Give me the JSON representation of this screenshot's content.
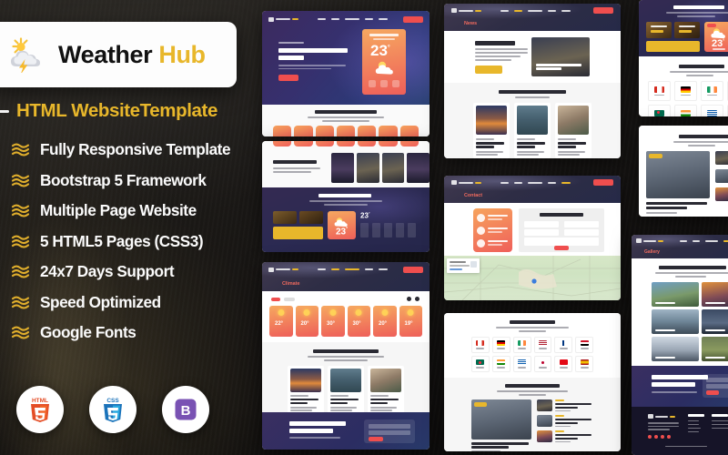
{
  "brand": {
    "name_primary": "Weather",
    "name_accent": "Hub",
    "icon": "sun-cloud-lightning-icon",
    "subtitle": "HTML WebsiteTemplate",
    "accent_color": "#e8b72b",
    "background_color": "#141210"
  },
  "features": [
    {
      "icon": "wave-bullet-icon",
      "label": "Fully Responsive Template"
    },
    {
      "icon": "wave-bullet-icon",
      "label": "Bootstrap 5 Framework"
    },
    {
      "icon": "wave-bullet-icon",
      "label": "Multiple Page Website"
    },
    {
      "icon": "wave-bullet-icon",
      "label": "5 HTML5 Pages (CSS3)"
    },
    {
      "icon": "wave-bullet-icon",
      "label": "24x7 Days Support"
    },
    {
      "icon": "wave-bullet-icon",
      "label": "Speed Optimized"
    },
    {
      "icon": "wave-bullet-icon",
      "label": "Google Fonts"
    }
  ],
  "tech_badges": [
    {
      "icon": "html5-icon",
      "label": "HTML",
      "number": "5",
      "color": "#e44d26"
    },
    {
      "icon": "css3-icon",
      "label": "CSS",
      "number": "3",
      "color": "#1b73ba"
    },
    {
      "icon": "bootstrap-icon",
      "label": "B",
      "number": "",
      "color": "#7952b3"
    }
  ],
  "mockups": {
    "home_hero": {
      "name": "Home",
      "nav_links": [
        "Home",
        "News",
        "Climate Change",
        "Gallery",
        "Contact"
      ],
      "nav_button": "Contact",
      "kicker": "Weather & Forecast",
      "title": "Daily Weather Forecast Update News",
      "button": "Read More",
      "card": {
        "city": "Bashibhishan",
        "date": "Monday, 20 Feb",
        "temp": "23",
        "unit": "°",
        "metrics": [
          "Wind",
          "Humidity",
          "Rain"
        ]
      }
    },
    "weekly": {
      "title": "Weekly Weather Forecast",
      "subtitle": "Lorem ipsum dolor sit amet consectetur adipisicing elit",
      "day_count": 7
    },
    "recent_search": {
      "title": "Recent Search Weather",
      "subtitle": "Lorem ipsum dolor sit amet consectetur adipisicing elit sed do",
      "cities": [
        "Dubai",
        "New York",
        "Sydney",
        "Paris"
      ]
    },
    "hourly": {
      "title": "Today Hourly Weather",
      "subtitle": "Lorem ipsum dolor sit amet consectetur adipisicing",
      "sunrise_label": "Sunrise",
      "sunrise_time": "6:15 am",
      "sunset_label": "Sunset",
      "sunset_time": "7:30 pm",
      "temp": "23",
      "unit": "°C",
      "hours": [
        "11am",
        "12pm",
        "1pm",
        "2pm",
        "3pm"
      ]
    },
    "climate": {
      "page_title": "Climate",
      "breadcrumb": "Home / Climate",
      "tabs": [
        "Today",
        "Weekly"
      ],
      "cards": [
        {
          "temp": "22",
          "unit": "°C"
        },
        {
          "temp": "20",
          "unit": "°C"
        },
        {
          "temp": "30",
          "unit": "°C"
        },
        {
          "temp": "30",
          "unit": "°C"
        },
        {
          "temp": "20",
          "unit": "°C"
        },
        {
          "temp": "19",
          "unit": "°C"
        }
      ]
    },
    "around_news": {
      "title": "Around The Weather News",
      "subtitle": "Lorem ipsum dolor sit amet consectetur adipisicing elit",
      "link": "View Forecast",
      "articles": [
        {
          "meta": "Climate • Forecast",
          "title": "Snow Report Your Ski Helps Your Winter Sports"
        },
        {
          "meta": "Climate • Forecast",
          "title": "Spring Starts Earliest In The Last 10 Years"
        },
        {
          "meta": "Climate • Forecast",
          "title": "Monsoon And White Snow In The Mountains"
        }
      ]
    },
    "newsletter": {
      "title_line1": "Subscribe Our Newsletter",
      "title_line2": "For Weather Update",
      "subtitle": "Lorem ipsum dolor sit amet consectetur",
      "fields": [
        "Your Name",
        "Your Email"
      ],
      "button": "Submit"
    },
    "news_page": {
      "page_title": "News",
      "section_title": "Top Weather Update",
      "body": "Lorem ipsum dolor sit amet consectetur adipisicing elit sed do eiusmod tempor",
      "button": "Read More Update",
      "feature_headline": "Cold Weather And Snow Preparation Get Hit Forecast"
    },
    "contact_page": {
      "page_title": "Contact",
      "breadcrumb": "Home / Contact",
      "form_title": "Leave Us A Message",
      "info": [
        {
          "icon": "location-icon",
          "label": "Location",
          "value": "New York, USA"
        },
        {
          "icon": "phone-icon",
          "label": "Phone",
          "value": "+1 234 567 890"
        },
        {
          "icon": "mail-icon",
          "label": "Email",
          "value": "info@weatherhub.com"
        }
      ],
      "fields": [
        "Your Name",
        "Your Email",
        "Phone",
        "Subject",
        "Message"
      ],
      "button": "Submit"
    },
    "top_city": {
      "title": "Top City Forecast",
      "subtitle": "Lorem ipsum dolor sit amet consectetur adipisicing",
      "link": "View Forecast",
      "countries": [
        {
          "flag": "fl-ca",
          "name": "Canada"
        },
        {
          "flag": "fl-de",
          "name": "Germany"
        },
        {
          "flag": "fl-ie",
          "name": "Ireland"
        },
        {
          "flag": "fl-us",
          "name": "USA"
        },
        {
          "flag": "fl-fi",
          "name": "Finland"
        },
        {
          "flag": "fl-eg",
          "name": "Egypt"
        },
        {
          "flag": "fl-bd",
          "name": "Bangladesh"
        },
        {
          "flag": "fl-in",
          "name": "India"
        },
        {
          "flag": "fl-gr",
          "name": "Greece"
        },
        {
          "flag": "fl-jp",
          "name": "Japan"
        },
        {
          "flag": "fl-tr",
          "name": "Turkey"
        },
        {
          "flag": "fl-es",
          "name": "Sri Lanka"
        }
      ]
    },
    "forecast_news": {
      "title": "Weather Forecast News",
      "subtitle": "Lorem ipsum dolor sit amet consectetur adipisicing",
      "link": "View Forecast",
      "badge": "Climate",
      "main_headline": "One Of The Daily Rituals Of Non Nice Himself Dairy Come Of The Rituals",
      "main_meta": "Climate • 12 Feb 2023",
      "side_articles": [
        {
          "tag": "Climate",
          "title": "Cold Weather And Snow Preparation Get Hit Forecast",
          "meta": "12 Feb 2023"
        },
        {
          "tag": "Climate",
          "title": "Global Weather Is Getting Warmer Or Slower",
          "meta": "12 Feb 2023"
        },
        {
          "tag": "Climate",
          "title": "Some Sort Of The Wind Was Just Hiked Up Summer",
          "meta": "12 Feb 2023"
        }
      ]
    },
    "gallery_page": {
      "page_title": "Gallery",
      "section_title": "Weather Photos Around The World",
      "subtitle": "Lorem ipsum dolor sit amet consectetur adipisicing elit sed",
      "photos": [
        {
          "class": "ph-mount",
          "caption": "Mountain Snow"
        },
        {
          "class": "ph-dusk",
          "caption": "Desert Sunset"
        },
        {
          "class": "ph-fall",
          "caption": "Waterfall Mist"
        },
        {
          "class": "ph-eiffel",
          "caption": "Paris Skyline"
        },
        {
          "class": "ph-fount",
          "caption": "Winter Storm"
        },
        {
          "class": "ph-rainb",
          "caption": "Field Rainbow"
        }
      ]
    },
    "footer": {
      "brand": "Weather Hub",
      "about": "Lorem ipsum dolor sit amet consectetur adipisicing elit sed do",
      "col_titles": [
        "Quick Links",
        "Address",
        "Latest"
      ],
      "links": [
        "Home",
        "News",
        "Climate",
        "Gallery",
        "Contact"
      ],
      "address": [
        "New York, USA",
        "+1 234 567 890",
        "info@weatherhub.com"
      ],
      "copyright": "Copyright 2023 All Rights Reserved"
    }
  }
}
